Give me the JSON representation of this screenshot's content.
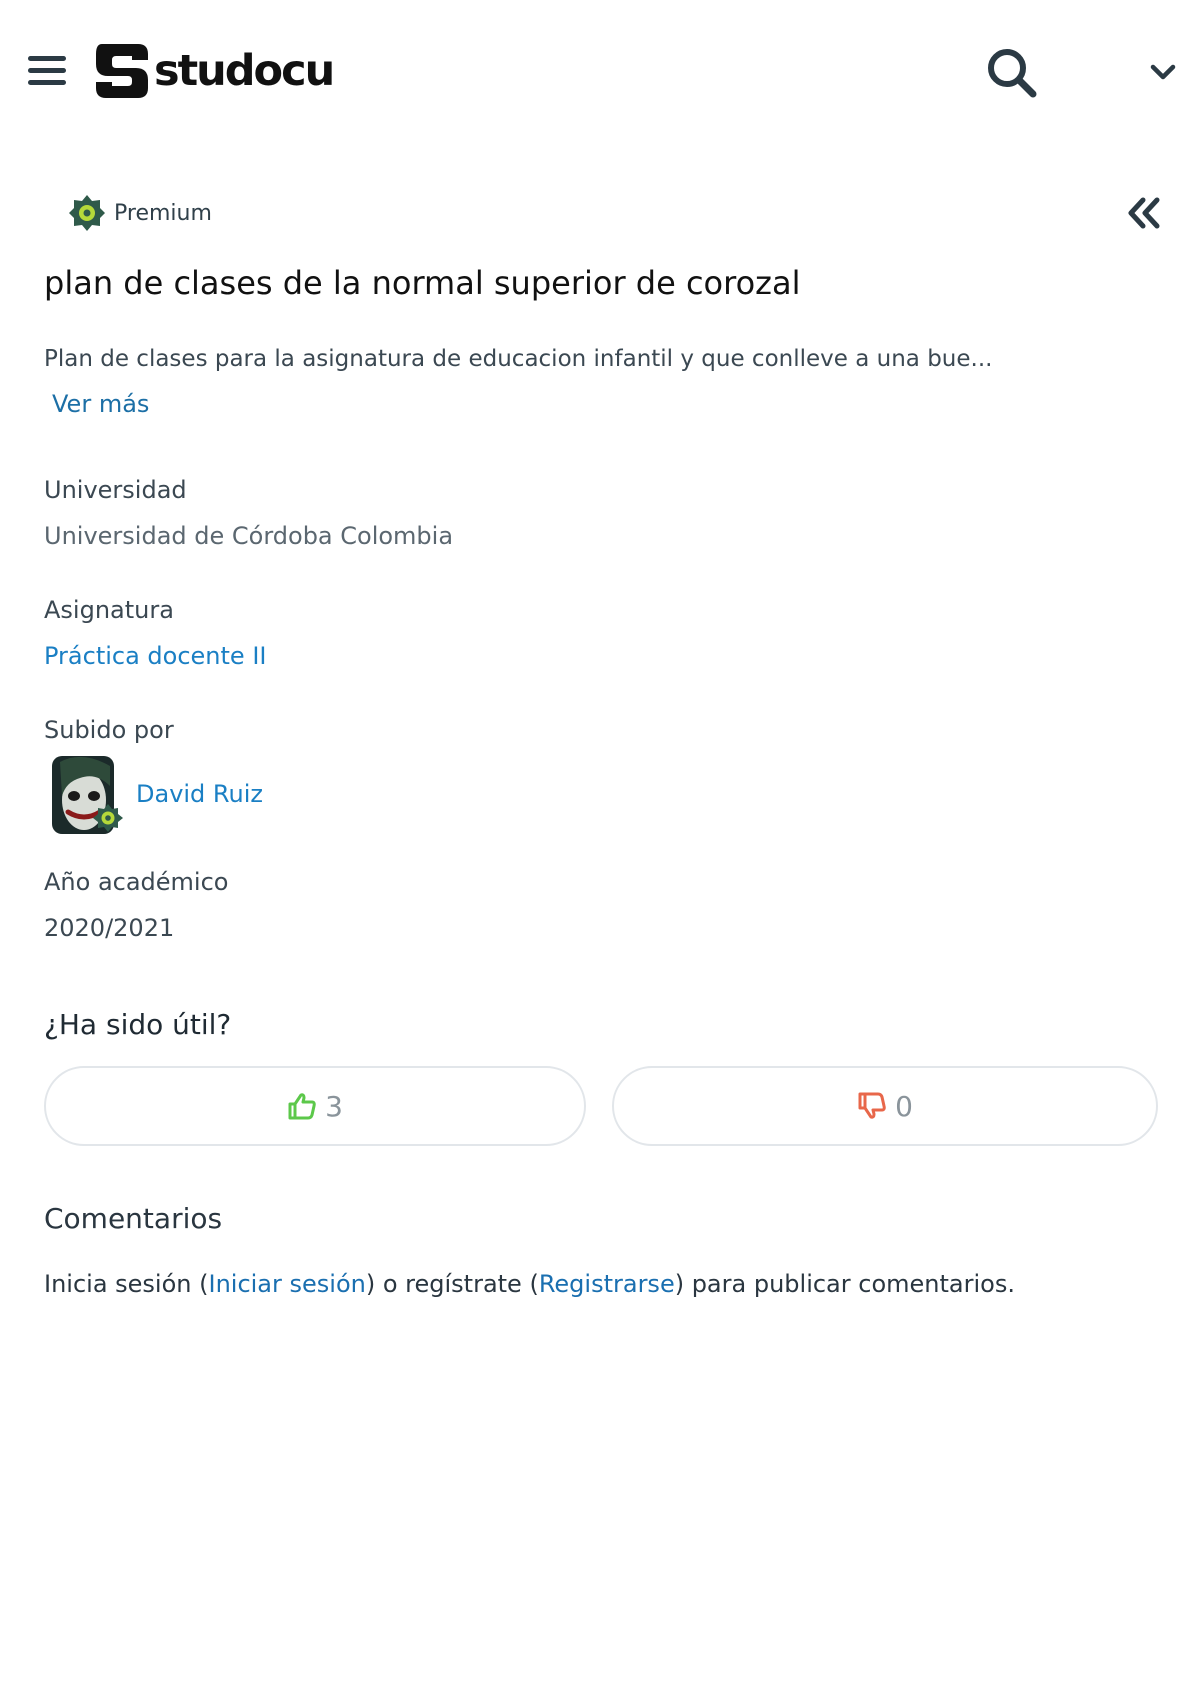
{
  "header": {
    "menu_icon": "hamburger-icon",
    "logo_text": "studocu",
    "search_icon": "search-icon",
    "dropdown_icon": "chevron-down-icon"
  },
  "document": {
    "premium_label": "Premium",
    "collapse_icon": "double-chevron-left-icon",
    "title": "plan de clases de la normal superior de corozal",
    "description": "Plan de clases para la asignatura de educacion infantil y que conlleve a una bue...",
    "see_more": "Ver más"
  },
  "details": {
    "university_label": "Universidad",
    "university_value": "Universidad de Córdoba Colombia",
    "course_label": "Asignatura",
    "course_value": "Práctica docente II",
    "uploaded_by_label": "Subido por",
    "uploader_name": "David Ruiz",
    "academic_year_label": "Año académico",
    "academic_year_value": "2020/2021"
  },
  "feedback": {
    "question": "¿Ha sido útil?",
    "upvotes": "3",
    "downvotes": "0",
    "up_color": "#5cc84a",
    "down_color": "#e8674a"
  },
  "comments": {
    "title": "Comentarios",
    "prefix": "Inicia sesión (",
    "login_link": "Iniciar sesión",
    "middle": ") o regístrate (",
    "register_link": "Registrarse",
    "suffix": ") para publicar comentarios."
  },
  "colors": {
    "link": "#1a7fc4",
    "premium_badge": "#2f5a4a",
    "premium_accent": "#b5d93a"
  }
}
